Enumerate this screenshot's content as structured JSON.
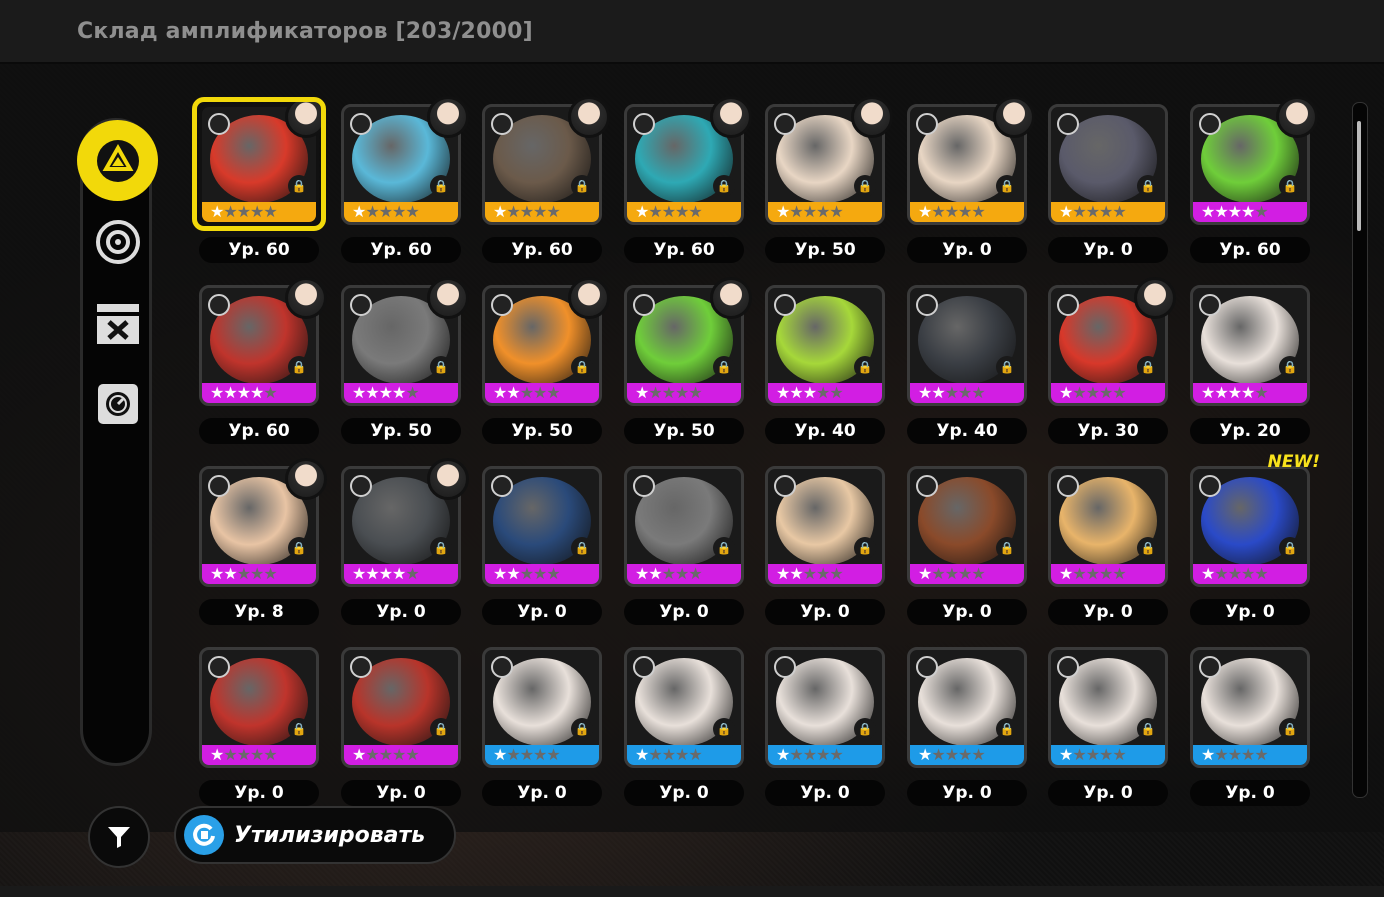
{
  "header": {
    "title": "Склад амплификаторов [203/2000]"
  },
  "sidebar": {
    "items": [
      {
        "name": "amplifier-tab",
        "icon": "triangle-badge-icon",
        "active": true
      },
      {
        "name": "disk-tab",
        "icon": "disk-icon",
        "active": false
      },
      {
        "name": "dismantle-tab",
        "icon": "cross-tools-icon",
        "active": false
      },
      {
        "name": "safe-tab",
        "icon": "safe-icon",
        "active": false
      }
    ]
  },
  "colors": {
    "accent": "#f2d90a",
    "gold": "#f5a90f",
    "purple": "#d21ee3",
    "blue": "#1e9be8",
    "panel": "#050505"
  },
  "items": [
    {
      "level": "Ур. 60",
      "rarity": "gold",
      "stars": 1,
      "selected": true,
      "avatar": true,
      "art": "#d83a2a"
    },
    {
      "level": "Ур. 60",
      "rarity": "gold",
      "stars": 1,
      "avatar": true,
      "art": "#5ab8d8"
    },
    {
      "level": "Ур. 60",
      "rarity": "gold",
      "stars": 1,
      "avatar": true,
      "art": "#6b5a4a"
    },
    {
      "level": "Ур. 60",
      "rarity": "gold",
      "stars": 1,
      "avatar": true,
      "art": "#2ea9b4"
    },
    {
      "level": "Ур. 50",
      "rarity": "gold",
      "stars": 1,
      "avatar": true,
      "art": "#e8d6c4"
    },
    {
      "level": "Ур. 0",
      "rarity": "gold",
      "stars": 1,
      "avatar": true,
      "art": "#e8d6c4"
    },
    {
      "level": "Ур. 0",
      "rarity": "gold",
      "stars": 1,
      "avatar": false,
      "art": "#5a5a6a"
    },
    {
      "level": "Ур. 60",
      "rarity": "purple",
      "stars": 4,
      "avatar": true,
      "art": "#6fce3a"
    },
    {
      "level": "Ур. 60",
      "rarity": "purple",
      "stars": 4,
      "avatar": true,
      "art": "#c0342c"
    },
    {
      "level": "Ур. 50",
      "rarity": "purple",
      "stars": 4,
      "avatar": true,
      "art": "#7a7a7a"
    },
    {
      "level": "Ур. 50",
      "rarity": "purple",
      "stars": 2,
      "avatar": true,
      "art": "#f0902a"
    },
    {
      "level": "Ур. 50",
      "rarity": "purple",
      "stars": 1,
      "avatar": true,
      "art": "#6fce3a"
    },
    {
      "level": "Ур. 40",
      "rarity": "purple",
      "stars": 3,
      "avatar": false,
      "art": "#a6d83a"
    },
    {
      "level": "Ур. 40",
      "rarity": "purple",
      "stars": 2,
      "avatar": false,
      "art": "#3a3e44"
    },
    {
      "level": "Ур. 30",
      "rarity": "purple",
      "stars": 1,
      "avatar": true,
      "art": "#d8382a"
    },
    {
      "level": "Ур. 20",
      "rarity": "purple",
      "stars": 4,
      "avatar": false,
      "art": "#e8e0da"
    },
    {
      "level": "Ур. 8",
      "rarity": "purple",
      "stars": 2,
      "avatar": true,
      "art": "#e8c4a4"
    },
    {
      "level": "Ур. 0",
      "rarity": "purple",
      "stars": 4,
      "avatar": true,
      "art": "#4a4e52"
    },
    {
      "level": "Ур. 0",
      "rarity": "purple",
      "stars": 2,
      "avatar": false,
      "art": "#2a4a7a"
    },
    {
      "level": "Ур. 0",
      "rarity": "purple",
      "stars": 2,
      "avatar": false,
      "art": "#7a7a7a"
    },
    {
      "level": "Ур. 0",
      "rarity": "purple",
      "stars": 2,
      "avatar": false,
      "art": "#e8c8a4"
    },
    {
      "level": "Ур. 0",
      "rarity": "purple",
      "stars": 1,
      "avatar": false,
      "art": "#8a4a2a"
    },
    {
      "level": "Ур. 0",
      "rarity": "purple",
      "stars": 1,
      "avatar": false,
      "art": "#e8b46a"
    },
    {
      "level": "Ур. 0",
      "rarity": "purple",
      "stars": 1,
      "avatar": false,
      "art": "#2a4ac8",
      "new": "NEW!"
    },
    {
      "level": "Ур. 0",
      "rarity": "purple",
      "stars": 1,
      "avatar": false,
      "art": "#c0342c"
    },
    {
      "level": "Ур. 0",
      "rarity": "purple",
      "stars": 1,
      "avatar": false,
      "art": "#b8342a"
    },
    {
      "level": "Ур. 0",
      "rarity": "blue",
      "stars": 1,
      "avatar": false,
      "art": "#e8e0da"
    },
    {
      "level": "Ур. 0",
      "rarity": "blue",
      "stars": 1,
      "avatar": false,
      "art": "#e8e0da"
    },
    {
      "level": "Ур. 0",
      "rarity": "blue",
      "stars": 1,
      "avatar": false,
      "art": "#e8e0da"
    },
    {
      "level": "Ур. 0",
      "rarity": "blue",
      "stars": 1,
      "avatar": false,
      "art": "#e8e0da"
    },
    {
      "level": "Ур. 0",
      "rarity": "blue",
      "stars": 1,
      "avatar": false,
      "art": "#e8e0da"
    },
    {
      "level": "Ур. 0",
      "rarity": "blue",
      "stars": 1,
      "avatar": false,
      "art": "#e8e0da"
    }
  ],
  "footer": {
    "dismantle_label": "Утилизировать",
    "filter_icon": "funnel-icon",
    "dismantle_icon": "recycle-icon"
  }
}
